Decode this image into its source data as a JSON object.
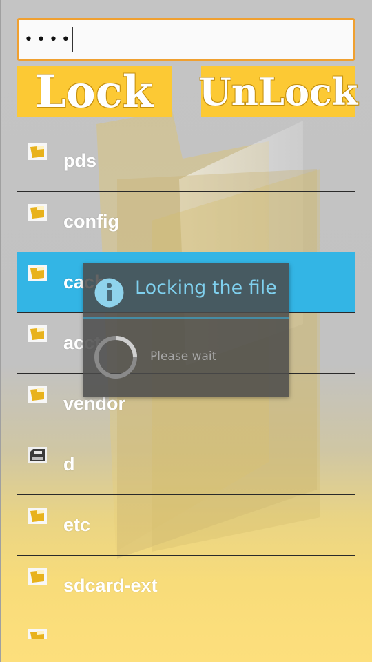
{
  "password": {
    "value": "••••"
  },
  "buttons": {
    "lock_label": "Lock",
    "unlock_label": "UnLock"
  },
  "colors": {
    "button_yellow": "#fcc934",
    "selected_row": "#33b5e5",
    "input_border": "#f0a030",
    "dialog_title": "#7fd0ee"
  },
  "files": [
    {
      "name": "pds",
      "icon": "folder-icon"
    },
    {
      "name": "config",
      "icon": "folder-icon"
    },
    {
      "name": "cache",
      "icon": "folder-icon",
      "selected": true
    },
    {
      "name": "acct",
      "icon": "folder-icon"
    },
    {
      "name": "vendor",
      "icon": "folder-icon"
    },
    {
      "name": "d",
      "icon": "drive-icon"
    },
    {
      "name": "etc",
      "icon": "folder-icon"
    },
    {
      "name": "sdcard-ext",
      "icon": "folder-icon"
    },
    {
      "name": "",
      "icon": "folder-icon"
    }
  ],
  "dialog": {
    "title": "Locking the file",
    "message": "Please wait",
    "icon": "info-icon"
  }
}
